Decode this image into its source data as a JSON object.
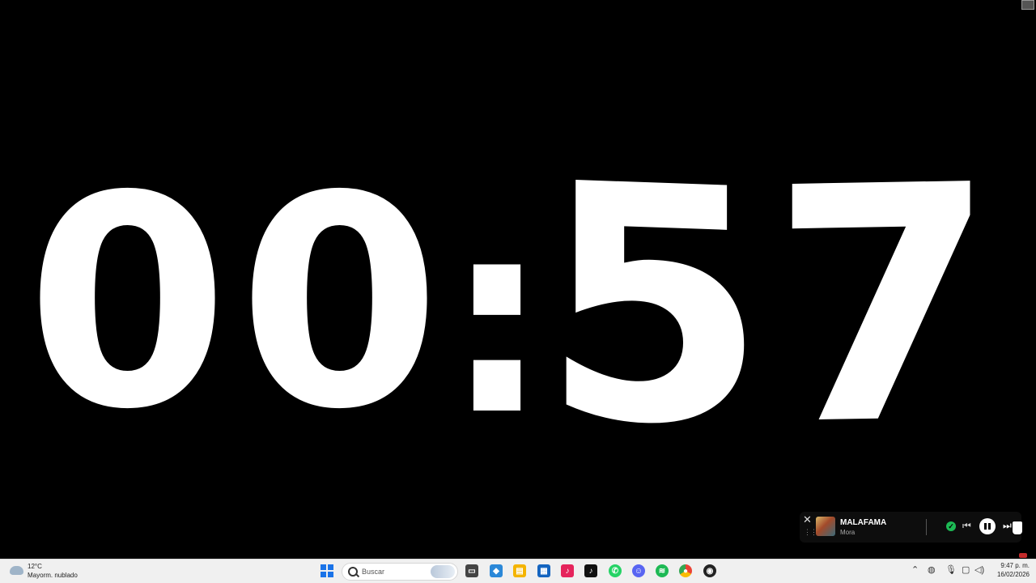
{
  "timer": {
    "d1": "0",
    "d2": "0",
    "colon": ":",
    "d3": "5",
    "d4": "7"
  },
  "media_player": {
    "title": "MALAFAMA",
    "artist": "Mora",
    "close_icon": "close-icon",
    "state": "playing",
    "accent": "#1db954"
  },
  "taskbar": {
    "weather": {
      "temp": "12°C",
      "desc": "Mayorm. nublado"
    },
    "search": {
      "placeholder": "Buscar"
    },
    "apps": [
      {
        "name": "task-view",
        "color": "#444444"
      },
      {
        "name": "copilot",
        "color": "#2b88d8"
      },
      {
        "name": "file-explorer",
        "color": "#f4b400"
      },
      {
        "name": "store",
        "color": "#1565c0"
      },
      {
        "name": "tiktok-red",
        "color": "#e5245c"
      },
      {
        "name": "tiktok",
        "color": "#111111"
      },
      {
        "name": "whatsapp",
        "color": "#25d366"
      },
      {
        "name": "discord",
        "color": "#5865f2"
      },
      {
        "name": "spotify",
        "color": "#1db954"
      },
      {
        "name": "chrome",
        "color": "#ea4335"
      },
      {
        "name": "obs",
        "color": "#222222"
      }
    ],
    "clock": {
      "time": "9:47 p. m.",
      "date": "16/02/2026"
    }
  }
}
